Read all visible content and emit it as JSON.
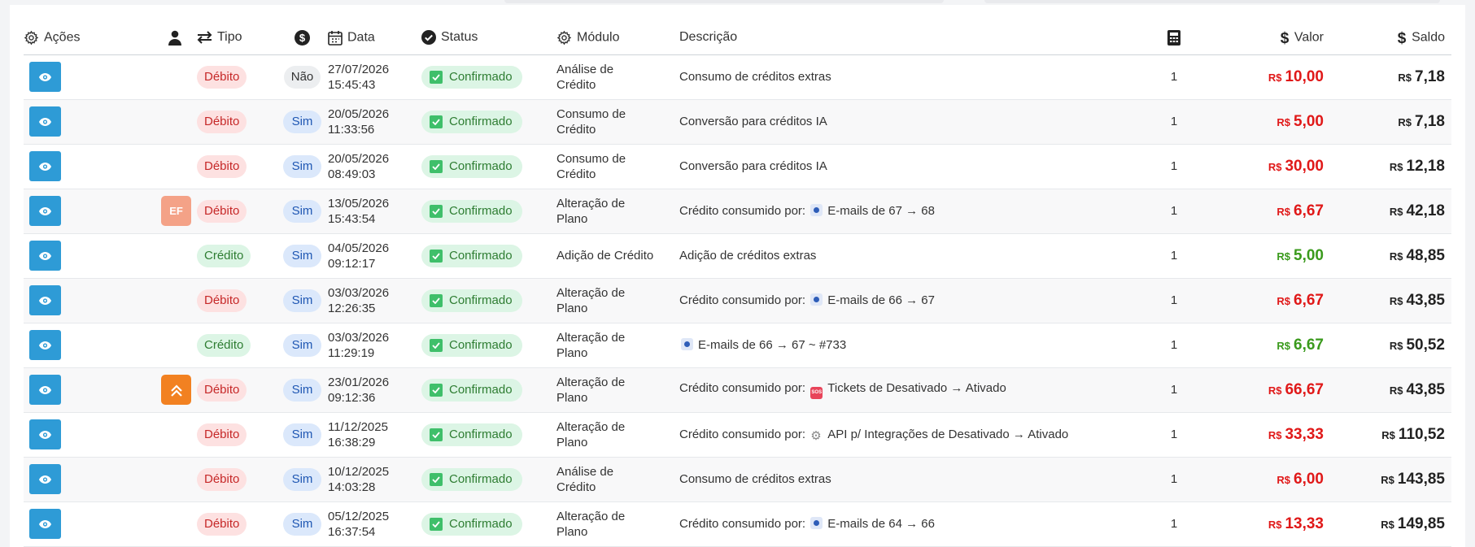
{
  "header": {
    "acoes": "Ações",
    "tipo": "Tipo",
    "data": "Data",
    "status": "Status",
    "modulo": "Módulo",
    "descricao": "Descrição",
    "valor": "Valor",
    "saldo": "Saldo"
  },
  "colors": {
    "accent": "#2e9bd6",
    "negative": "#e01818",
    "positive": "#3a9a1c"
  },
  "currency": "R$",
  "rows": [
    {
      "tipo": "Débito",
      "cobrado": "Não",
      "date": "27/07/2026",
      "time": "15:45:43",
      "status": "Confirmado",
      "modulo": [
        "Análise de",
        "Crédito"
      ],
      "desc_prefix": "Consumo de créditos extras",
      "desc_icon": "",
      "desc_text": "",
      "qty": "1",
      "valor": "10,00",
      "saldo": "7,18",
      "user": ""
    },
    {
      "tipo": "Débito",
      "cobrado": "Sim",
      "date": "20/05/2026",
      "time": "11:33:56",
      "status": "Confirmado",
      "modulo": [
        "Consumo de",
        "Crédito"
      ],
      "desc_prefix": "Conversão para créditos IA",
      "desc_icon": "",
      "desc_text": "",
      "qty": "1",
      "valor": "5,00",
      "saldo": "7,18",
      "user": ""
    },
    {
      "tipo": "Débito",
      "cobrado": "Sim",
      "date": "20/05/2026",
      "time": "08:49:03",
      "status": "Confirmado",
      "modulo": [
        "Consumo de",
        "Crédito"
      ],
      "desc_prefix": "Conversão para créditos IA",
      "desc_icon": "",
      "desc_text": "",
      "qty": "1",
      "valor": "30,00",
      "saldo": "12,18",
      "user": ""
    },
    {
      "tipo": "Débito",
      "cobrado": "Sim",
      "date": "13/05/2026",
      "time": "15:43:54",
      "status": "Confirmado",
      "modulo": [
        "Alteração de",
        "Plano"
      ],
      "desc_prefix": "Crédito consumido por:",
      "desc_icon": "mail",
      "desc_text": "E-mails de 67 → 68",
      "qty": "1",
      "valor": "6,67",
      "saldo": "42,18",
      "user": "EF"
    },
    {
      "tipo": "Crédito",
      "cobrado": "Sim",
      "date": "04/05/2026",
      "time": "09:12:17",
      "status": "Confirmado",
      "modulo": [
        "Adição de Crédito",
        ""
      ],
      "desc_prefix": "Adição de créditos extras",
      "desc_icon": "",
      "desc_text": "",
      "qty": "1",
      "valor": "5,00",
      "saldo": "48,85",
      "user": ""
    },
    {
      "tipo": "Débito",
      "cobrado": "Sim",
      "date": "03/03/2026",
      "time": "12:26:35",
      "status": "Confirmado",
      "modulo": [
        "Alteração de",
        "Plano"
      ],
      "desc_prefix": "Crédito consumido por:",
      "desc_icon": "mail",
      "desc_text": "E-mails de 66 → 67",
      "qty": "1",
      "valor": "6,67",
      "saldo": "43,85",
      "user": ""
    },
    {
      "tipo": "Crédito",
      "cobrado": "Sim",
      "date": "03/03/2026",
      "time": "11:29:19",
      "status": "Confirmado",
      "modulo": [
        "Alteração de",
        "Plano"
      ],
      "desc_prefix": "",
      "desc_icon": "mail",
      "desc_text": "E-mails de 66 → 67 ~ #733",
      "qty": "1",
      "valor": "6,67",
      "saldo": "50,52",
      "user": ""
    },
    {
      "tipo": "Débito",
      "cobrado": "Sim",
      "date": "23/01/2026",
      "time": "09:12:36",
      "status": "Confirmado",
      "modulo": [
        "Alteração de",
        "Plano"
      ],
      "desc_prefix": "Crédito consumido por:",
      "desc_icon": "sos",
      "desc_text": "Tickets de Desativado → Ativado",
      "qty": "1",
      "valor": "66,67",
      "saldo": "43,85",
      "user": "UP"
    },
    {
      "tipo": "Débito",
      "cobrado": "Sim",
      "date": "11/12/2025",
      "time": "16:38:29",
      "status": "Confirmado",
      "modulo": [
        "Alteração de",
        "Plano"
      ],
      "desc_prefix": "Crédito consumido por:",
      "desc_icon": "gear",
      "desc_text": "API p/ Integrações de Desativado → Ativado",
      "qty": "1",
      "valor": "33,33",
      "saldo": "110,52",
      "user": ""
    },
    {
      "tipo": "Débito",
      "cobrado": "Sim",
      "date": "10/12/2025",
      "time": "14:03:28",
      "status": "Confirmado",
      "modulo": [
        "Análise de",
        "Crédito"
      ],
      "desc_prefix": "Consumo de créditos extras",
      "desc_icon": "",
      "desc_text": "",
      "qty": "1",
      "valor": "6,00",
      "saldo": "143,85",
      "user": ""
    },
    {
      "tipo": "Débito",
      "cobrado": "Sim",
      "date": "05/12/2025",
      "time": "16:37:54",
      "status": "Confirmado",
      "modulo": [
        "Alteração de",
        "Plano"
      ],
      "desc_prefix": "Crédito consumido por:",
      "desc_icon": "mail",
      "desc_text": "E-mails de 64 → 66",
      "qty": "1",
      "valor": "13,33",
      "saldo": "149,85",
      "user": ""
    }
  ]
}
